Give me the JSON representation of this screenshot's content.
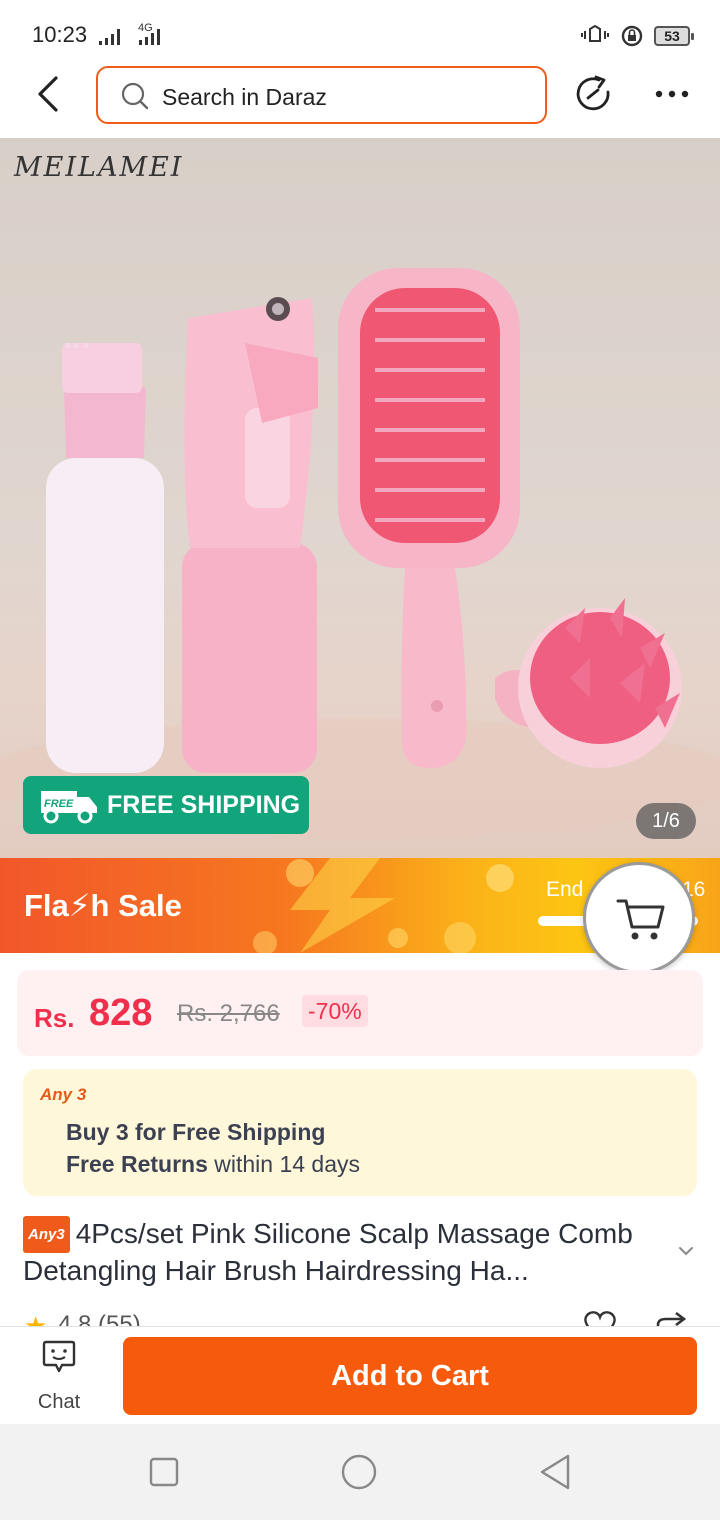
{
  "status_bar": {
    "time": "10:23",
    "network": "4G",
    "battery": "53"
  },
  "header": {
    "search_placeholder": "Search in Daraz"
  },
  "gallery": {
    "brand_watermark": "MEILAMEI",
    "free_shipping_label": "FREE SHIPPING",
    "free_tag": "FREE",
    "counter": "1/6"
  },
  "flash_sale": {
    "title": "Fla⚡h  Sale",
    "ends_label": "End",
    "ends_value": "16"
  },
  "price": {
    "currency": "Rs.",
    "current": "828",
    "original": "Rs. 2,766",
    "discount": "-70%"
  },
  "promo": {
    "tag": "Any 3",
    "line1": "Buy 3 for  Free Shipping",
    "line2_bold": "Free Returns",
    "line2_rest": " within 14 days"
  },
  "product": {
    "badge": "Any3",
    "title": "4Pcs/set Pink Silicone Scalp Massage Comb Detangling Hair Brush Hairdressing Ha...",
    "rating_text": "4.8 (55)"
  },
  "bottom_bar": {
    "chat_label": "Chat",
    "add_to_cart_label": "Add to Cart"
  },
  "colors": {
    "accent": "#f65a0c",
    "price_red": "#ef2f4b",
    "free_shipping_green": "#12a57c"
  }
}
